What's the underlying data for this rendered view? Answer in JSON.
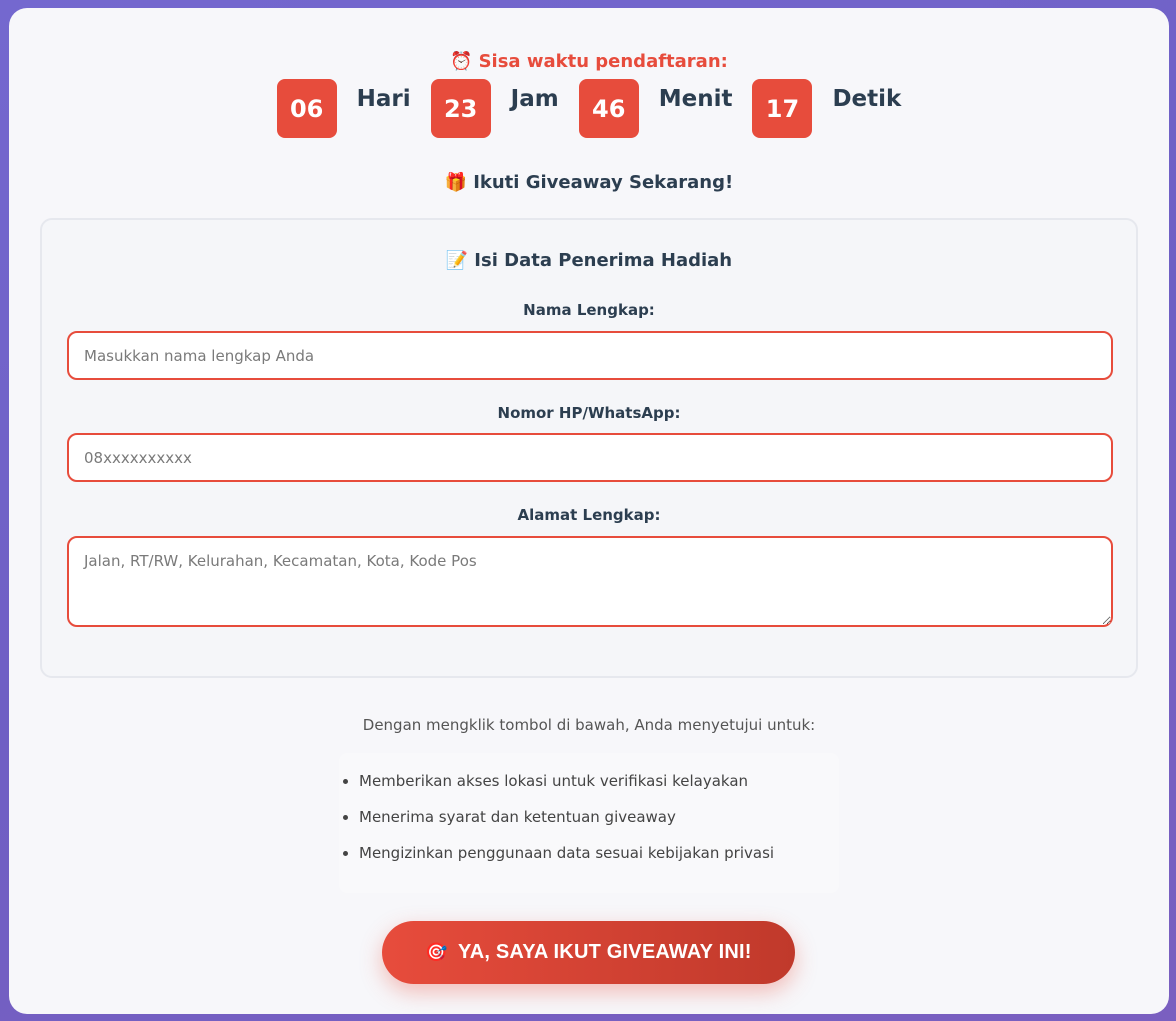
{
  "timer": {
    "title": "Sisa waktu pendaftaran:",
    "icon": "⏰",
    "units": [
      {
        "value": "06",
        "label": "Hari"
      },
      {
        "value": "23",
        "label": "Jam"
      },
      {
        "value": "46",
        "label": "Menit"
      },
      {
        "value": "17",
        "label": "Detik"
      }
    ]
  },
  "join": {
    "icon": "🎁",
    "title": "Ikuti Giveaway Sekarang!"
  },
  "form": {
    "icon": "📝",
    "title": "Isi Data Penerima Hadiah",
    "name_label": "Nama Lengkap:",
    "name_placeholder": "Masukkan nama lengkap Anda",
    "phone_label": "Nomor HP/WhatsApp:",
    "phone_placeholder": "08xxxxxxxxxx",
    "address_label": "Alamat Lengkap:",
    "address_placeholder": "Jalan, RT/RW, Kelurahan, Kecamatan, Kota, Kode Pos"
  },
  "agreement": {
    "intro": "Dengan mengklik tombol di bawah, Anda menyetujui untuk:",
    "items": [
      "Memberikan akses lokasi untuk verifikasi kelayakan",
      "Menerima syarat dan ketentuan giveaway",
      "Mengizinkan penggunaan data sesuai kebijakan privasi"
    ]
  },
  "cta": {
    "icon": "🎯",
    "label": "YA, SAYA IKUT GIVEAWAY INI!"
  },
  "colors": {
    "accent": "#e74c3c",
    "text": "#2c3e50",
    "background": "#7468cf"
  }
}
